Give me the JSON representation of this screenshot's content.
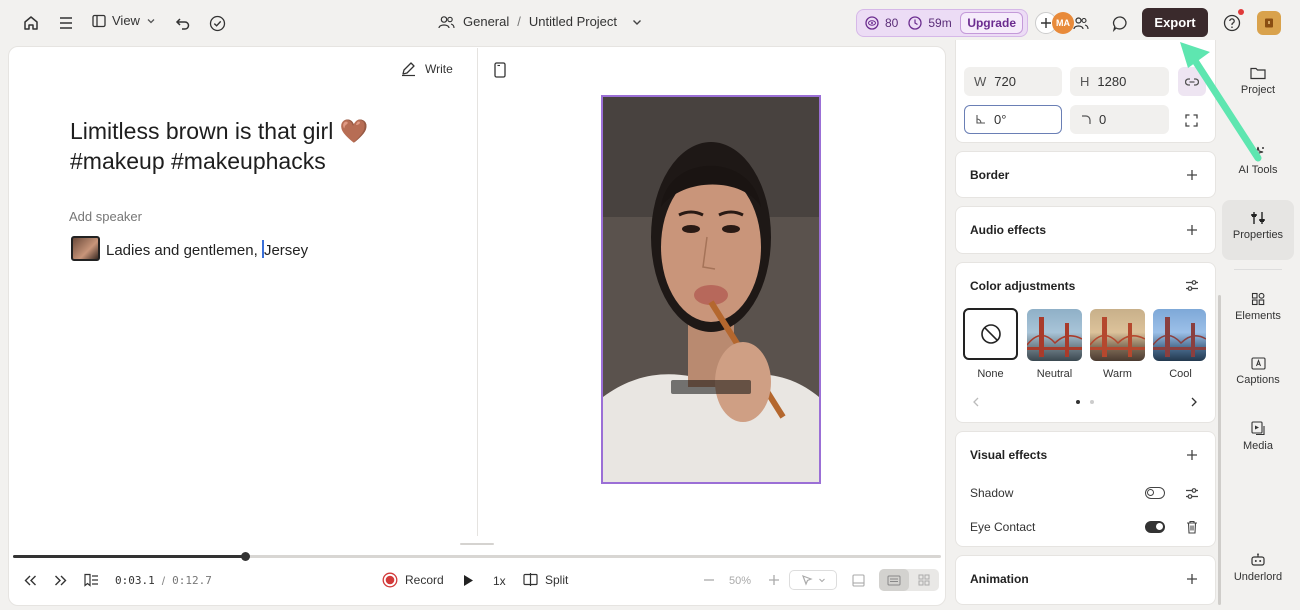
{
  "topbar": {
    "view_label": "View",
    "workspace": "General",
    "separator": "/",
    "project": "Untitled Project",
    "stat_credits": "80",
    "stat_minutes": "59m",
    "upgrade_label": "Upgrade",
    "avatar_initials": "MA",
    "export_label": "Export"
  },
  "script": {
    "write_label": "Write",
    "title": "Limitless brown is that girl 🤎 #makeup #makeuphacks",
    "add_speaker": "Add speaker",
    "transcript_before": "Ladies and gentlemen, ",
    "transcript_after": "Jersey"
  },
  "timeline": {
    "current_time": "0:03.1",
    "time_sep": "/",
    "total_time": "0:12.7",
    "record_label": "Record",
    "speed_label": "1x",
    "split_label": "Split",
    "zoom": "50%",
    "progress": 0.25
  },
  "properties": {
    "w_label": "W",
    "w_value": "720",
    "h_label": "H",
    "h_value": "1280",
    "rotation_value": "0°",
    "corner_value": "0",
    "border_title": "Border",
    "audio_title": "Audio effects",
    "color_title": "Color adjustments",
    "filters": [
      {
        "label": "None"
      },
      {
        "label": "Neutral"
      },
      {
        "label": "Warm"
      },
      {
        "label": "Cool"
      }
    ],
    "visual_title": "Visual effects",
    "shadow_label": "Shadow",
    "eye_contact_label": "Eye Contact",
    "animation_title": "Animation"
  },
  "sidebar": {
    "items": [
      {
        "label": "Project"
      },
      {
        "label": "AI Tools"
      },
      {
        "label": "Properties"
      },
      {
        "label": "Elements"
      },
      {
        "label": "Captions"
      },
      {
        "label": "Media"
      },
      {
        "label": "Underlord"
      }
    ]
  },
  "colors": {
    "accent_purple": "#9b6fd6",
    "export_bg": "#3a2a2c",
    "arrow": "#5ee6b0"
  }
}
